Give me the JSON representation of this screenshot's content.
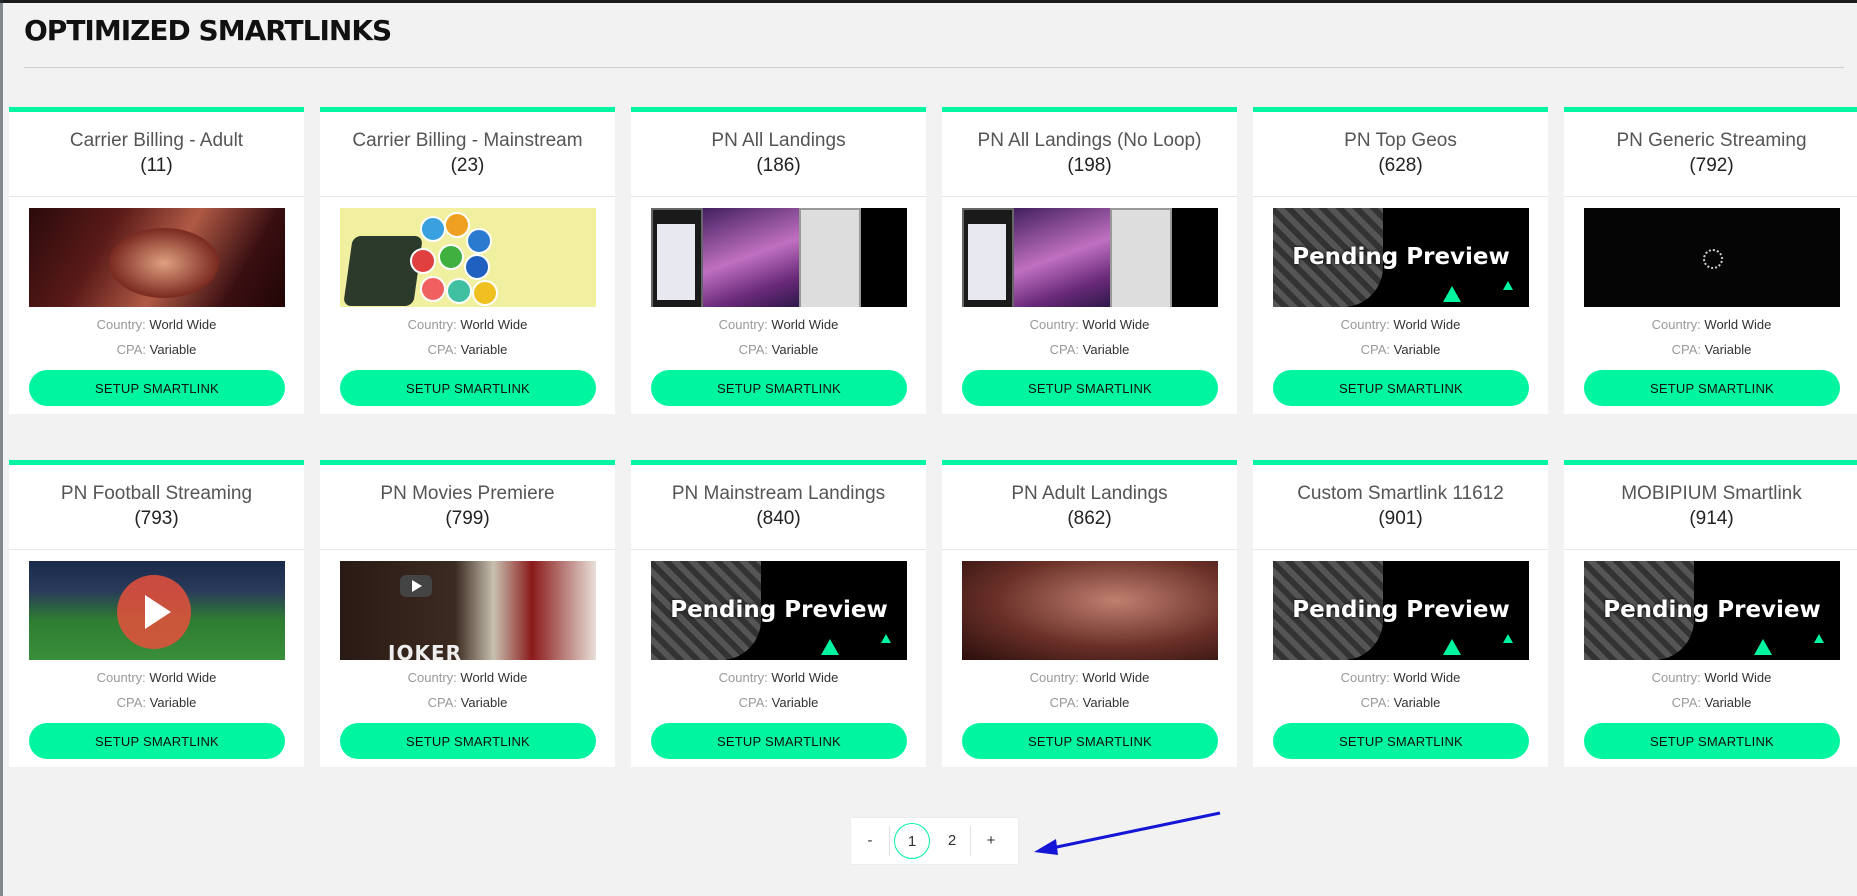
{
  "page": {
    "title": "OPTIMIZED SMARTLINKS"
  },
  "cards": [
    {
      "name": "Carrier Billing - Adult",
      "id": "(11)",
      "thumb": "adult-photo",
      "country_label": "Country:",
      "country": "World Wide",
      "cpa_label": "CPA:",
      "cpa": "Variable",
      "button": "SETUP SMARTLINK"
    },
    {
      "name": "Carrier Billing - Mainstream",
      "id": "(23)",
      "thumb": "app-icons",
      "country_label": "Country:",
      "country": "World Wide",
      "cpa_label": "CPA:",
      "cpa": "Variable",
      "button": "SETUP SMARTLINK"
    },
    {
      "name": "PN All Landings",
      "id": "(186)",
      "thumb": "landing-screens",
      "country_label": "Country:",
      "country": "World Wide",
      "cpa_label": "CPA:",
      "cpa": "Variable",
      "button": "SETUP SMARTLINK"
    },
    {
      "name": "PN All Landings (No Loop)",
      "id": "(198)",
      "thumb": "landing-screens",
      "country_label": "Country:",
      "country": "World Wide",
      "cpa_label": "CPA:",
      "cpa": "Variable",
      "button": "SETUP SMARTLINK"
    },
    {
      "name": "PN Top Geos",
      "id": "(628)",
      "thumb": "pending-preview",
      "thumb_label": "Pending Preview",
      "country_label": "Country:",
      "country": "World Wide",
      "cpa_label": "CPA:",
      "cpa": "Variable",
      "button": "SETUP SMARTLINK"
    },
    {
      "name": "PN Generic Streaming",
      "id": "(792)",
      "thumb": "loading-spinner",
      "country_label": "Country:",
      "country": "World Wide",
      "cpa_label": "CPA:",
      "cpa": "Variable",
      "button": "SETUP SMARTLINK"
    },
    {
      "name": "PN Football Streaming",
      "id": "(793)",
      "thumb": "football-play",
      "country_label": "Country:",
      "country": "World Wide",
      "cpa_label": "CPA:",
      "cpa": "Variable",
      "button": "SETUP SMARTLINK"
    },
    {
      "name": "PN Movies Premiere",
      "id": "(799)",
      "thumb": "movie-poster",
      "thumb_label": "JOKER",
      "country_label": "Country:",
      "country": "World Wide",
      "cpa_label": "CPA:",
      "cpa": "Variable",
      "button": "SETUP SMARTLINK"
    },
    {
      "name": "PN Mainstream Landings",
      "id": "(840)",
      "thumb": "pending-preview",
      "thumb_label": "Pending Preview",
      "country_label": "Country:",
      "country": "World Wide",
      "cpa_label": "CPA:",
      "cpa": "Variable",
      "button": "SETUP SMARTLINK"
    },
    {
      "name": "PN Adult Landings",
      "id": "(862)",
      "thumb": "adult-photo-2",
      "country_label": "Country:",
      "country": "World Wide",
      "cpa_label": "CPA:",
      "cpa": "Variable",
      "button": "SETUP SMARTLINK"
    },
    {
      "name": "Custom Smartlink 11612",
      "id": "(901)",
      "thumb": "pending-preview",
      "thumb_label": "Pending Preview",
      "country_label": "Country:",
      "country": "World Wide",
      "cpa_label": "CPA:",
      "cpa": "Variable",
      "button": "SETUP SMARTLINK"
    },
    {
      "name": "MOBIPIUM Smartlink",
      "id": "(914)",
      "thumb": "pending-preview",
      "thumb_label": "Pending Preview",
      "country_label": "Country:",
      "country": "World Wide",
      "cpa_label": "CPA:",
      "cpa": "Variable",
      "button": "SETUP SMARTLINK"
    }
  ],
  "pagination": {
    "prev": "-",
    "pages": [
      "1",
      "2"
    ],
    "current": "1",
    "next": "+"
  },
  "colors": {
    "accent": "#00f5a0",
    "annotation_arrow": "#1515d6"
  }
}
